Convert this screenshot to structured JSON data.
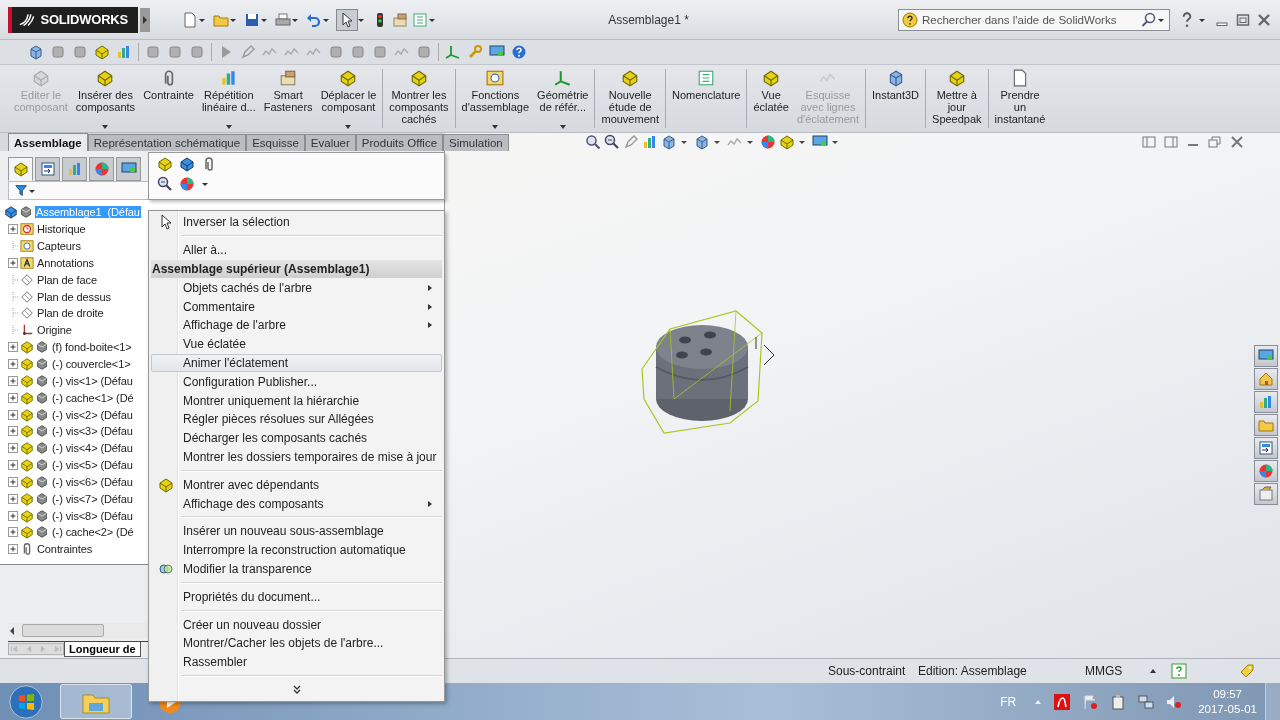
{
  "title_bar": {
    "app": "SOLIDWORKS",
    "title": "Assemblage1 *",
    "search": {
      "placeholder": "Rechercher dans l'aide de SolidWorks"
    }
  },
  "ribbon": [
    {
      "label": "Editer le\ncomposant",
      "disabled": true,
      "dropdown": false,
      "separator_after": false
    },
    {
      "label": "Insérer des\ncomposants",
      "disabled": false,
      "dropdown": true,
      "separator_after": false
    },
    {
      "label": "Contrainte",
      "disabled": false,
      "dropdown": false,
      "separator_after": false
    },
    {
      "label": "Répétition\nlinéaire d...",
      "disabled": false,
      "dropdown": true,
      "separator_after": false
    },
    {
      "label": "Smart\nFasteners",
      "disabled": false,
      "dropdown": false,
      "separator_after": false
    },
    {
      "label": "Déplacer le\ncomposant",
      "disabled": false,
      "dropdown": true,
      "separator_after": true
    },
    {
      "label": "Montrer les\ncomposants\ncachés",
      "disabled": false,
      "dropdown": false,
      "separator_after": true
    },
    {
      "label": "Fonctions\nd'assemblage",
      "disabled": false,
      "dropdown": true,
      "separator_after": false
    },
    {
      "label": "Géométrie\nde référ...",
      "disabled": false,
      "dropdown": true,
      "separator_after": true
    },
    {
      "label": "Nouvelle\nétude de\nmouvement",
      "disabled": false,
      "dropdown": false,
      "separator_after": true
    },
    {
      "label": "Nomenclature",
      "disabled": false,
      "dropdown": false,
      "separator_after": true
    },
    {
      "label": "Vue\néclatée",
      "disabled": false,
      "dropdown": false,
      "separator_after": false
    },
    {
      "label": "Esquisse\navec lignes\nd'éclatement",
      "disabled": true,
      "dropdown": false,
      "separator_after": true
    },
    {
      "label": "Instant3D",
      "disabled": false,
      "dropdown": false,
      "separator_after": true
    },
    {
      "label": "Mettre à\njour\nSpeedpak",
      "disabled": false,
      "dropdown": false,
      "separator_after": true
    },
    {
      "label": "Prendre\nun\ninstantané",
      "disabled": false,
      "dropdown": false,
      "separator_after": false
    }
  ],
  "command_tabs": [
    {
      "label": "Assemblage",
      "selected": true
    },
    {
      "label": "Représentation schématique",
      "selected": false
    },
    {
      "label": "Esquisse",
      "selected": false
    },
    {
      "label": "Evaluer",
      "selected": false
    },
    {
      "label": "Produits Office",
      "selected": false
    },
    {
      "label": "Simulation",
      "selected": false
    }
  ],
  "panel_tabs": [
    {
      "selected": true
    },
    {
      "selected": false
    },
    {
      "selected": false
    },
    {
      "selected": false
    },
    {
      "selected": false
    }
  ],
  "tree": {
    "label": "Assemblage1  (Défau",
    "selected": true,
    "children": [
      {
        "label": "Historique",
        "kind": "history",
        "expandable": true,
        "selected": false
      },
      {
        "label": "Capteurs",
        "kind": "sensor",
        "expandable": false,
        "selected": false
      },
      {
        "label": "Annotations",
        "kind": "annotation",
        "expandable": true,
        "selected": false
      },
      {
        "label": "Plan de face",
        "kind": "plane",
        "expandable": false,
        "selected": false
      },
      {
        "label": "Plan de dessus",
        "kind": "plane",
        "expandable": false,
        "selected": false
      },
      {
        "label": "Plan de droite",
        "kind": "plane",
        "expandable": false,
        "selected": false
      },
      {
        "label": "Origine",
        "kind": "origin",
        "expandable": false,
        "selected": false
      },
      {
        "label": "(f) fond-boite<1>",
        "kind": "component",
        "expandable": true,
        "selected": false
      },
      {
        "label": "(-) couvercle<1>",
        "kind": "component",
        "expandable": true,
        "selected": false
      },
      {
        "label": "(-) vis<1> (Défau",
        "kind": "component",
        "expandable": true,
        "selected": false
      },
      {
        "label": "(-) cache<1> (Dé",
        "kind": "component",
        "expandable": true,
        "selected": false
      },
      {
        "label": "(-) vis<2> (Défau",
        "kind": "component",
        "expandable": true,
        "selected": false
      },
      {
        "label": "(-) vis<3> (Défau",
        "kind": "component",
        "expandable": true,
        "selected": false
      },
      {
        "label": "(-) vis<4> (Défau",
        "kind": "component",
        "expandable": true,
        "selected": false
      },
      {
        "label": "(-) vis<5> (Défau",
        "kind": "component",
        "expandable": true,
        "selected": false
      },
      {
        "label": "(-) vis<6> (Défau",
        "kind": "component",
        "expandable": true,
        "selected": false
      },
      {
        "label": "(-) vis<7> (Défau",
        "kind": "component",
        "expandable": true,
        "selected": false
      },
      {
        "label": "(-) vis<8> (Défau",
        "kind": "component",
        "expandable": true,
        "selected": false
      },
      {
        "label": "(-) cache<2> (Dé",
        "kind": "component",
        "expandable": true,
        "selected": false
      },
      {
        "label": "Contraintes",
        "kind": "mates",
        "expandable": true,
        "selected": false
      }
    ]
  },
  "bottom_tab": "Longueur de",
  "context_menu": {
    "items": [
      {
        "kind": "item",
        "label": "Inverser la sélection",
        "icon": true,
        "submenu": false,
        "selected": false
      },
      {
        "kind": "separator"
      },
      {
        "kind": "item",
        "label": "Aller à...",
        "icon": false,
        "submenu": false,
        "selected": false
      },
      {
        "kind": "header",
        "label": "Assemblage supérieur (Assemblage1)"
      },
      {
        "kind": "item",
        "label": "Objets cachés de l'arbre",
        "icon": false,
        "submenu": true,
        "selected": false
      },
      {
        "kind": "item",
        "label": "Commentaire",
        "icon": false,
        "submenu": true,
        "selected": false
      },
      {
        "kind": "item",
        "label": "Affichage de l'arbre",
        "icon": false,
        "submenu": true,
        "selected": false
      },
      {
        "kind": "item",
        "label": "Vue éclatée",
        "icon": false,
        "submenu": false,
        "selected": false
      },
      {
        "kind": "item",
        "label": "Animer l'éclatement",
        "icon": false,
        "submenu": false,
        "selected": true
      },
      {
        "kind": "item",
        "label": "Configuration Publisher...",
        "icon": false,
        "submenu": false,
        "selected": false
      },
      {
        "kind": "item",
        "label": "Montrer uniquement la hiérarchie",
        "icon": false,
        "submenu": false,
        "selected": false
      },
      {
        "kind": "item",
        "label": "Régler pièces résolues sur Allégées",
        "icon": false,
        "submenu": false,
        "selected": false
      },
      {
        "kind": "item",
        "label": "Décharger les composants cachés",
        "icon": false,
        "submenu": false,
        "selected": false
      },
      {
        "kind": "item",
        "label": "Montrer les dossiers temporaires de mise à jour",
        "icon": false,
        "submenu": false,
        "selected": false
      },
      {
        "kind": "separator"
      },
      {
        "kind": "item",
        "label": "Montrer avec dépendants",
        "icon": true,
        "submenu": false,
        "selected": false
      },
      {
        "kind": "item",
        "label": "Affichage des composants",
        "icon": false,
        "submenu": true,
        "selected": false
      },
      {
        "kind": "separator"
      },
      {
        "kind": "item",
        "label": "Insérer un nouveau sous-assemblage",
        "icon": false,
        "submenu": false,
        "selected": false
      },
      {
        "kind": "item",
        "label": "Interrompre la reconstruction automatique",
        "icon": false,
        "submenu": false,
        "selected": false
      },
      {
        "kind": "item",
        "label": "Modifier la transparence",
        "icon": true,
        "submenu": false,
        "selected": false
      },
      {
        "kind": "separator"
      },
      {
        "kind": "item",
        "label": "Propriétés du document...",
        "icon": false,
        "submenu": false,
        "selected": false
      },
      {
        "kind": "separator"
      },
      {
        "kind": "item",
        "label": "Créer un nouveau dossier",
        "icon": false,
        "submenu": false,
        "selected": false
      },
      {
        "kind": "item",
        "label": "Montrer/Cacher les objets de l'arbre...",
        "icon": false,
        "submenu": false,
        "selected": false
      },
      {
        "kind": "item",
        "label": "Rassembler",
        "icon": false,
        "submenu": false,
        "selected": false
      },
      {
        "kind": "separator"
      },
      {
        "kind": "more"
      }
    ]
  },
  "status_bar": [
    "Sous-contraint",
    "Edition: Assemblage",
    "MMGS"
  ],
  "taskbar": {
    "language": "FR",
    "time": "09:57",
    "date": "2017-05-01"
  }
}
